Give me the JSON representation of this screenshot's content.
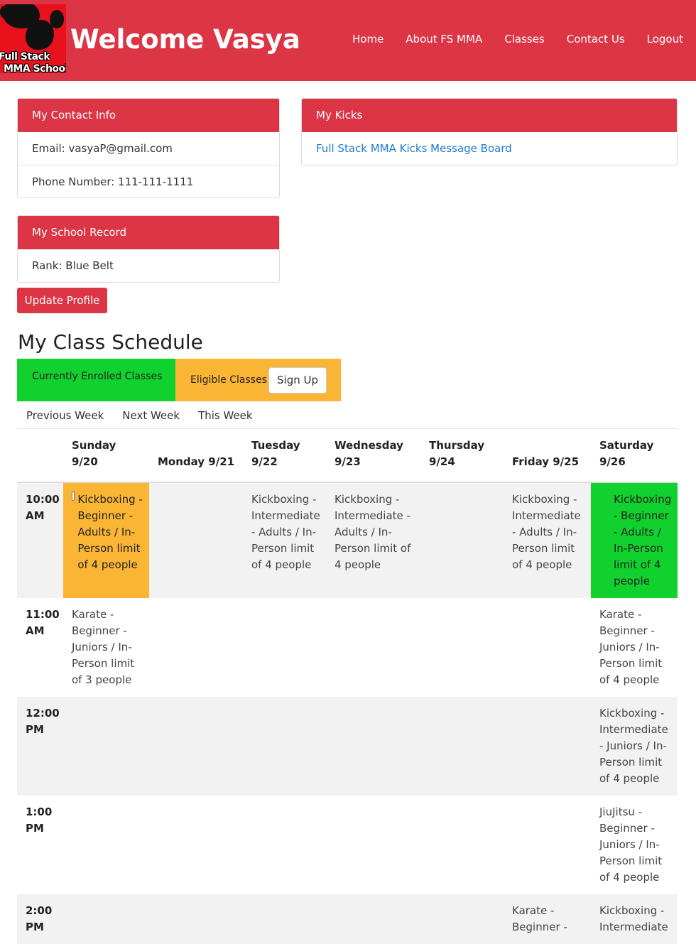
{
  "navbar": {
    "logo_line1": "Full Stack",
    "logo_line2": "MMA School",
    "title": "Welcome Vasya",
    "links": [
      "Home",
      "About FS MMA",
      "Classes",
      "Contact Us",
      "Logout"
    ]
  },
  "contact": {
    "heading": "My Contact Info",
    "email": "Email: vasyaP@gmail.com",
    "phone": "Phone Number: 111-111-1111"
  },
  "kicks": {
    "heading": "My Kicks",
    "link": "Full Stack MMA Kicks Message Board"
  },
  "record": {
    "heading": "My School Record",
    "rank": "Rank: Blue Belt"
  },
  "update_button": "Update Profile",
  "schedule": {
    "title": "My Class Schedule",
    "legend_enrolled": "Currently Enrolled Classes",
    "legend_eligible": "Eligible Classes",
    "signup_button": "Sign Up",
    "week_nav": [
      "Previous Week",
      "Next Week",
      "This Week"
    ],
    "days": [
      "Sunday 9/20",
      "Monday 9/21",
      "Tuesday 9/22",
      "Wednesday 9/23",
      "Thursday 9/24",
      "Friday 9/25",
      "Saturday 9/26"
    ],
    "rows": [
      {
        "time": "10:00 AM",
        "cells": [
          "Kickboxing - Beginner - Adults / In-Person limit of 4 people",
          "",
          "Kickboxing - Intermediate - Adults / In-Person limit of 4 people",
          "Kickboxing - Intermediate - Adults / In-Person limit of 4 people",
          "",
          "Kickboxing - Intermediate - Adults / In-Person limit of 4 people",
          "Kickboxing - Beginner - Adults / In-Person limit of 4 people"
        ]
      },
      {
        "time": "11:00 AM",
        "cells": [
          "Karate - Beginner - Juniors / In-Person limit of 3 people",
          "",
          "",
          "",
          "",
          "",
          "Karate - Beginner - Juniors / In-Person limit of 4 people"
        ]
      },
      {
        "time": "12:00 PM",
        "cells": [
          "",
          "",
          "",
          "",
          "",
          "",
          "Kickboxing - Intermediate - Juniors / In-Person limit of 4 people"
        ]
      },
      {
        "time": "1:00 PM",
        "cells": [
          "",
          "",
          "",
          "",
          "",
          "",
          "JiuJitsu - Beginner - Juniors / In-Person limit of 4 people"
        ]
      },
      {
        "time": "2:00 PM",
        "cells": [
          "",
          "",
          "",
          "",
          "",
          "Karate - Beginner -",
          "Kickboxing - Intermediate"
        ]
      }
    ]
  },
  "colors": {
    "brand_red": "#dc3545",
    "enrolled_green": "#10d12e",
    "eligible_orange": "#fbb535"
  }
}
